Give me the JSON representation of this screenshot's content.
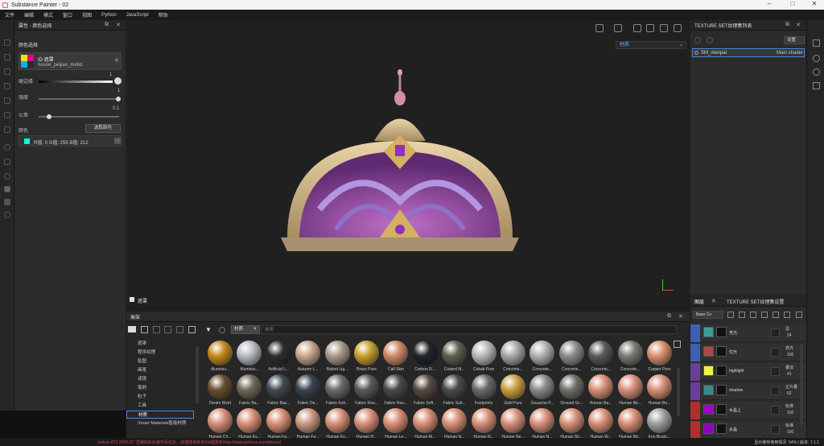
{
  "window": {
    "title": "Substance Painter - 02"
  },
  "menu": [
    "文件",
    "编辑",
    "模式",
    "窗口",
    "视图",
    "Python",
    "JavaScript",
    "帮助"
  ],
  "properties_panel": {
    "title": "属性 - 颜色选择",
    "section": "颜色选择",
    "id_label": "ID 遮罩",
    "mesh_name": "house_peijian_metid",
    "hardness_label": "硬边缘",
    "hardness_value": "1",
    "brightness_label": "强度",
    "brightness_value": "1",
    "tolerance_label": "公差",
    "tolerance_value": "0.1",
    "color_label": "颜色",
    "pick_button": "选取颜色",
    "color_values": "R值: 0  G值: 255  B值: 212"
  },
  "viewport": {
    "view_mode": "材质",
    "bottom_label": "遮罩"
  },
  "texture_set_list": {
    "title": "TEXTURE SET纹理集列表",
    "settings": "设置",
    "item_name": "SM_menpai",
    "item_shader": "Main shader"
  },
  "layers_panel": {
    "tab_layers": "图层",
    "tab_settings": "TEXTURE SET纹理集设置",
    "channel": "Base Co",
    "layers": [
      {
        "name": "亮光",
        "blend": "滤",
        "opacity": "24",
        "color": "#3a9e98",
        "eye": "#3f5fb0"
      },
      {
        "name": "优光",
        "blend": "亮光",
        "opacity": "100",
        "color": "#b04848",
        "eye": "#3f5fb0"
      },
      {
        "name": "highlight",
        "blend": "叠加",
        "opacity": "41",
        "color": "#f0f04a",
        "eye": "#6a3f9a"
      },
      {
        "name": "shadow",
        "blend": "正片叠",
        "opacity": "62",
        "color": "#3a8a8a",
        "eye": "#6a3f9a"
      },
      {
        "name": "水晶上",
        "blend": "标准",
        "opacity": "100",
        "color": "#a000d0",
        "eye": "#b03030"
      },
      {
        "name": "水晶",
        "blend": "标准",
        "opacity": "100",
        "color": "#9000c0",
        "eye": "#b03030"
      }
    ]
  },
  "shelf": {
    "title": "展架",
    "filter_tag": "材质",
    "search_placeholder": "搜索",
    "categories": [
      "遮罩",
      "程序纹理",
      "贴图",
      "画笔",
      "滤镜",
      "笔刷",
      "粒子",
      "工具",
      "材质",
      "Smart Materials智能材质"
    ],
    "materials": [
      {
        "name": "Aluminiu...",
        "color": "#c48a1e"
      },
      {
        "name": "Aluminiu...",
        "color": "#b8bcc2"
      },
      {
        "name": "Artificial L...",
        "color": "#2d2d2d"
      },
      {
        "name": "Autumn L...",
        "color": "#c8a890"
      },
      {
        "name": "Baked Lig...",
        "color": "#a89a8a"
      },
      {
        "name": "Brass Pure",
        "color": "#c8a030"
      },
      {
        "name": "Calf Skin",
        "color": "#d08868"
      },
      {
        "name": "Carbon Fi...",
        "color": "#202428"
      },
      {
        "name": "Coated M...",
        "color": "#606050"
      },
      {
        "name": "Cobalt Pure",
        "color": "#b8b8b8"
      },
      {
        "name": "Concrete...",
        "color": "#a8a8a8"
      },
      {
        "name": "Concrete...",
        "color": "#b0b0b0"
      },
      {
        "name": "Concrete...",
        "color": "#8c8c8c"
      },
      {
        "name": "Concrete...",
        "color": "#5a5a5a"
      },
      {
        "name": "Concrete...",
        "color": "#7a7870"
      },
      {
        "name": "Copper Pure",
        "color": "#d89070"
      },
      {
        "name": "Denim Rivet",
        "color": "#6a5030"
      },
      {
        "name": "Fabric Ba...",
        "color": "#706a58"
      },
      {
        "name": "Fabric Bas...",
        "color": "#404a50"
      },
      {
        "name": "Fabric De...",
        "color": "#3a4450"
      },
      {
        "name": "Fabric Knit...",
        "color": "#6a6a6a"
      },
      {
        "name": "Fabric Rou...",
        "color": "#5a5a5a"
      },
      {
        "name": "Fabric Rou...",
        "color": "#4a4a4a"
      },
      {
        "name": "Fabric Soft...",
        "color": "#5a4a40"
      },
      {
        "name": "Fabric Suit...",
        "color": "#4a4a4a"
      },
      {
        "name": "Footprints",
        "color": "#6a6a6a"
      },
      {
        "name": "Gold Pure",
        "color": "#c8a040"
      },
      {
        "name": "Gouache P...",
        "color": "#8a8a8a"
      },
      {
        "name": "Ground Gr...",
        "color": "#707068"
      },
      {
        "name": "Human Ba...",
        "color": "#d89078"
      },
      {
        "name": "Human Be...",
        "color": "#d89078"
      },
      {
        "name": "Human Bu...",
        "color": "#d89078"
      },
      {
        "name": "Human Ch...",
        "color": "#d89078"
      },
      {
        "name": "Human Ey...",
        "color": "#d89078"
      },
      {
        "name": "Human Fa...",
        "color": "#d89078"
      },
      {
        "name": "Human Fe...",
        "color": "#c89a80"
      },
      {
        "name": "Human Fo...",
        "color": "#d89078"
      },
      {
        "name": "Human H...",
        "color": "#d89078"
      },
      {
        "name": "Human Le...",
        "color": "#d89078"
      },
      {
        "name": "Human M...",
        "color": "#d89078"
      },
      {
        "name": "Human N...",
        "color": "#d89078"
      },
      {
        "name": "Human N...",
        "color": "#d89078"
      },
      {
        "name": "Human Ne...",
        "color": "#d89078"
      },
      {
        "name": "Human N...",
        "color": "#d89078"
      },
      {
        "name": "Human Sh...",
        "color": "#d89078"
      },
      {
        "name": "Human W...",
        "color": "#d89078"
      },
      {
        "name": "Human Wr...",
        "color": "#d89078"
      },
      {
        "name": "Iron Brush...",
        "color": "#a0a0a0"
      }
    ]
  },
  "status": {
    "message": "...before 8T3 2000 31\" 您缓的彩彩装件百位外...  纹理体更新实6%理更新(http://www.gofocus.com/drivers)",
    "right": "显示缓存使用情况: 54% | 版本: 7.1.1"
  }
}
